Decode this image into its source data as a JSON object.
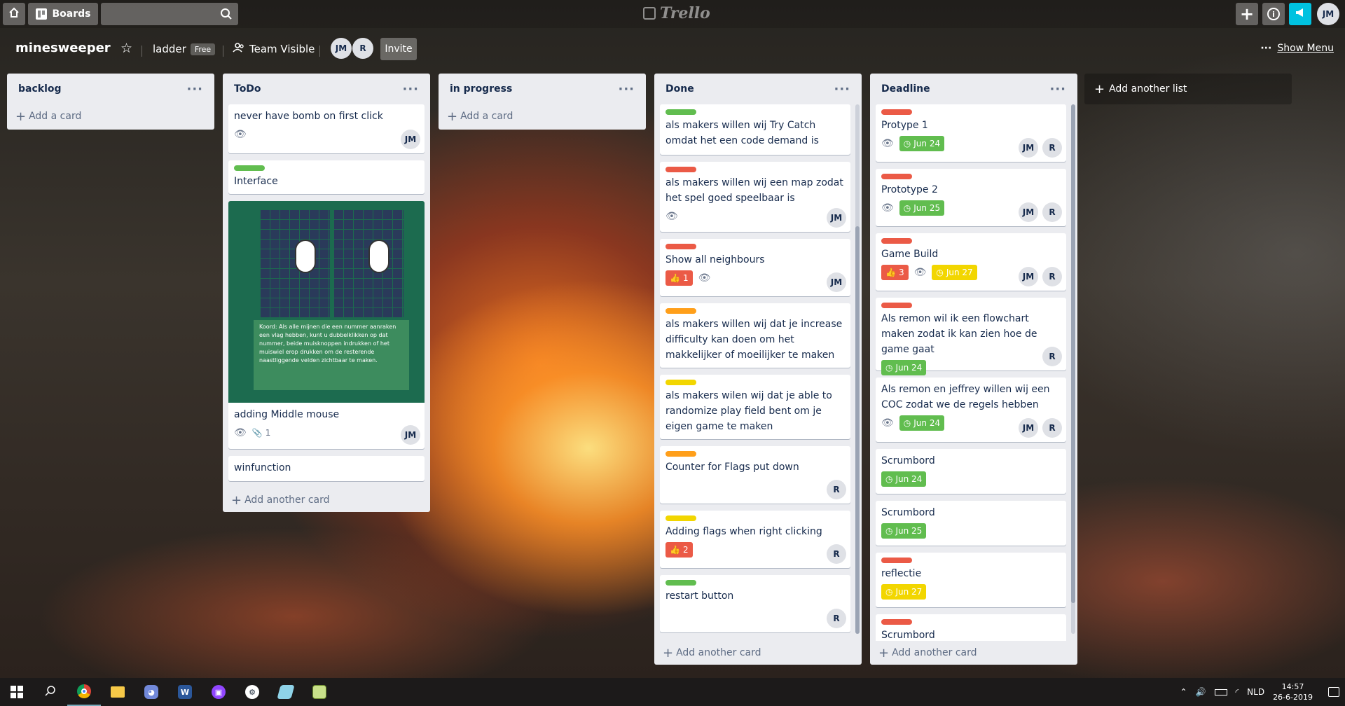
{
  "topbar": {
    "boards_label": "Boards",
    "logo": "Trello",
    "user_initials": "JM"
  },
  "board": {
    "name": "minesweeper",
    "team_name": "ladder",
    "plan": "Free",
    "visibility": "Team Visible",
    "members": [
      "JM",
      "R"
    ],
    "invite_label": "Invite",
    "menu_label": "Show Menu"
  },
  "lists": [
    {
      "title": "backlog",
      "add_label": "Add a card",
      "cards": []
    },
    {
      "title": "ToDo",
      "add_label": "Add another card",
      "cards": [
        {
          "title": "never have bomb on first click",
          "labels": [],
          "watch": true,
          "members": [
            "JM"
          ]
        },
        {
          "title": "Interface",
          "labels": [
            "#61bd4f"
          ],
          "members": []
        },
        {
          "title": "adding Middle mouse",
          "cover": true,
          "watch": true,
          "attachments": "1",
          "members": [
            "JM"
          ]
        },
        {
          "title": "winfunction",
          "labels": [],
          "members": []
        }
      ]
    },
    {
      "title": "in progress",
      "add_label": "Add a card",
      "cards": []
    },
    {
      "title": "Done",
      "add_label": "Add another card",
      "cards": [
        {
          "title": "als makers willen wij Try Catch omdat het een code demand is",
          "labels": [
            "#61bd4f"
          ],
          "members": []
        },
        {
          "title": "als makers willen wij een map zodat het spel goed speelbaar is",
          "labels": [
            "#eb5a46"
          ],
          "watch": true,
          "members": [
            "JM"
          ]
        },
        {
          "title": "Show all neighbours",
          "labels": [
            "#eb5a46"
          ],
          "votes": "1",
          "watch": true,
          "members": [
            "JM"
          ]
        },
        {
          "title": "als makers willen wij dat je increase difficulty kan doen om het makkelijker of moeilijker te maken",
          "labels": [
            "#ff9f1a"
          ],
          "members": []
        },
        {
          "title": "als makers wilen wij dat je able to randomize play field bent om je eigen game te maken",
          "labels": [
            "#f2d600"
          ],
          "members": []
        },
        {
          "title": "Counter for Flags put down",
          "labels": [
            "#ff9f1a"
          ],
          "members": [
            "R"
          ]
        },
        {
          "title": "Adding flags when right clicking",
          "labels": [
            "#f2d600"
          ],
          "votes": "2",
          "members": [
            "R"
          ]
        },
        {
          "title": "restart button",
          "labels": [
            "#61bd4f"
          ],
          "members": [
            "R"
          ]
        }
      ]
    },
    {
      "title": "Deadline",
      "add_label": "Add another card",
      "cards": [
        {
          "title": "Protype 1",
          "labels": [
            "#eb5a46"
          ],
          "watch": true,
          "due": "Jun 24",
          "due_color": "green",
          "members": [
            "JM",
            "R"
          ]
        },
        {
          "title": "Prototype 2",
          "labels": [
            "#eb5a46"
          ],
          "watch": true,
          "due": "Jun 25",
          "due_color": "green",
          "members": [
            "JM",
            "R"
          ]
        },
        {
          "title": "Game Build",
          "labels": [
            "#eb5a46"
          ],
          "votes": "3",
          "watch": true,
          "due": "Jun 27",
          "due_color": "yellow",
          "members": [
            "JM",
            "R"
          ]
        },
        {
          "title": "Als remon wil ik een flowchart maken zodat ik kan zien hoe de game gaat",
          "labels": [
            "#eb5a46"
          ],
          "due": "Jun 24",
          "due_color": "green",
          "members": [
            "R"
          ]
        },
        {
          "title": "Als remon en jeffrey willen wij een COC zodat we de regels hebben",
          "labels": [],
          "watch": true,
          "due": "Jun 24",
          "due_color": "green",
          "members": [
            "JM",
            "R"
          ]
        },
        {
          "title": "Scrumbord",
          "labels": [],
          "due": "Jun 24",
          "due_color": "green",
          "members": []
        },
        {
          "title": "Scrumbord",
          "labels": [],
          "due": "Jun 25",
          "due_color": "green",
          "members": []
        },
        {
          "title": "reflectie",
          "labels": [
            "#eb5a46"
          ],
          "due": "Jun 27",
          "due_color": "yellow",
          "members": []
        },
        {
          "title": "Scrumbord",
          "labels": [
            "#eb5a46"
          ],
          "members": []
        }
      ]
    }
  ],
  "add_list_label": "Add another list",
  "cover_caption": "Koord: Als alle mijnen die een nummer aanraken een vlag hebben, kunt u dubbelklikken op dat nummer, beide muisknoppen indrukken of het muiswiel erop drukken om de resterende naastliggende velden zichtbaar te maken.",
  "taskbar": {
    "language": "NLD",
    "time": "14:57",
    "date": "26-6-2019"
  },
  "colors": {
    "green": "#61bd4f",
    "red": "#eb5a46",
    "orange": "#ff9f1a",
    "yellow": "#f2d600"
  }
}
